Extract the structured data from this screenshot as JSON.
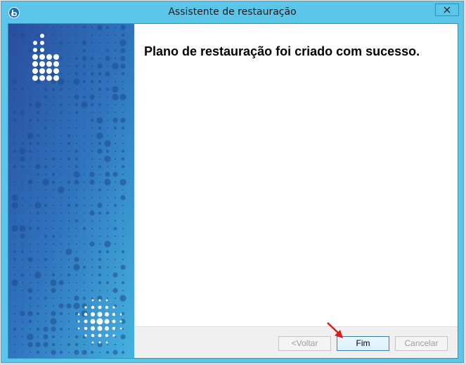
{
  "window": {
    "title": "Assistente de restauração"
  },
  "content": {
    "heading": "Plano de restauração foi criado com sucesso."
  },
  "footer": {
    "back_label": "<Voltar",
    "finish_label": "Fim",
    "cancel_label": "Cancelar"
  },
  "colors": {
    "titlebar": "#5bc6ea",
    "sidebar_top": "#2a56a8",
    "sidebar_bottom": "#3fa5d8",
    "annotation_arrow": "#e0191b"
  },
  "icons": [
    "app-icon",
    "close-icon",
    "annotation-arrow"
  ]
}
